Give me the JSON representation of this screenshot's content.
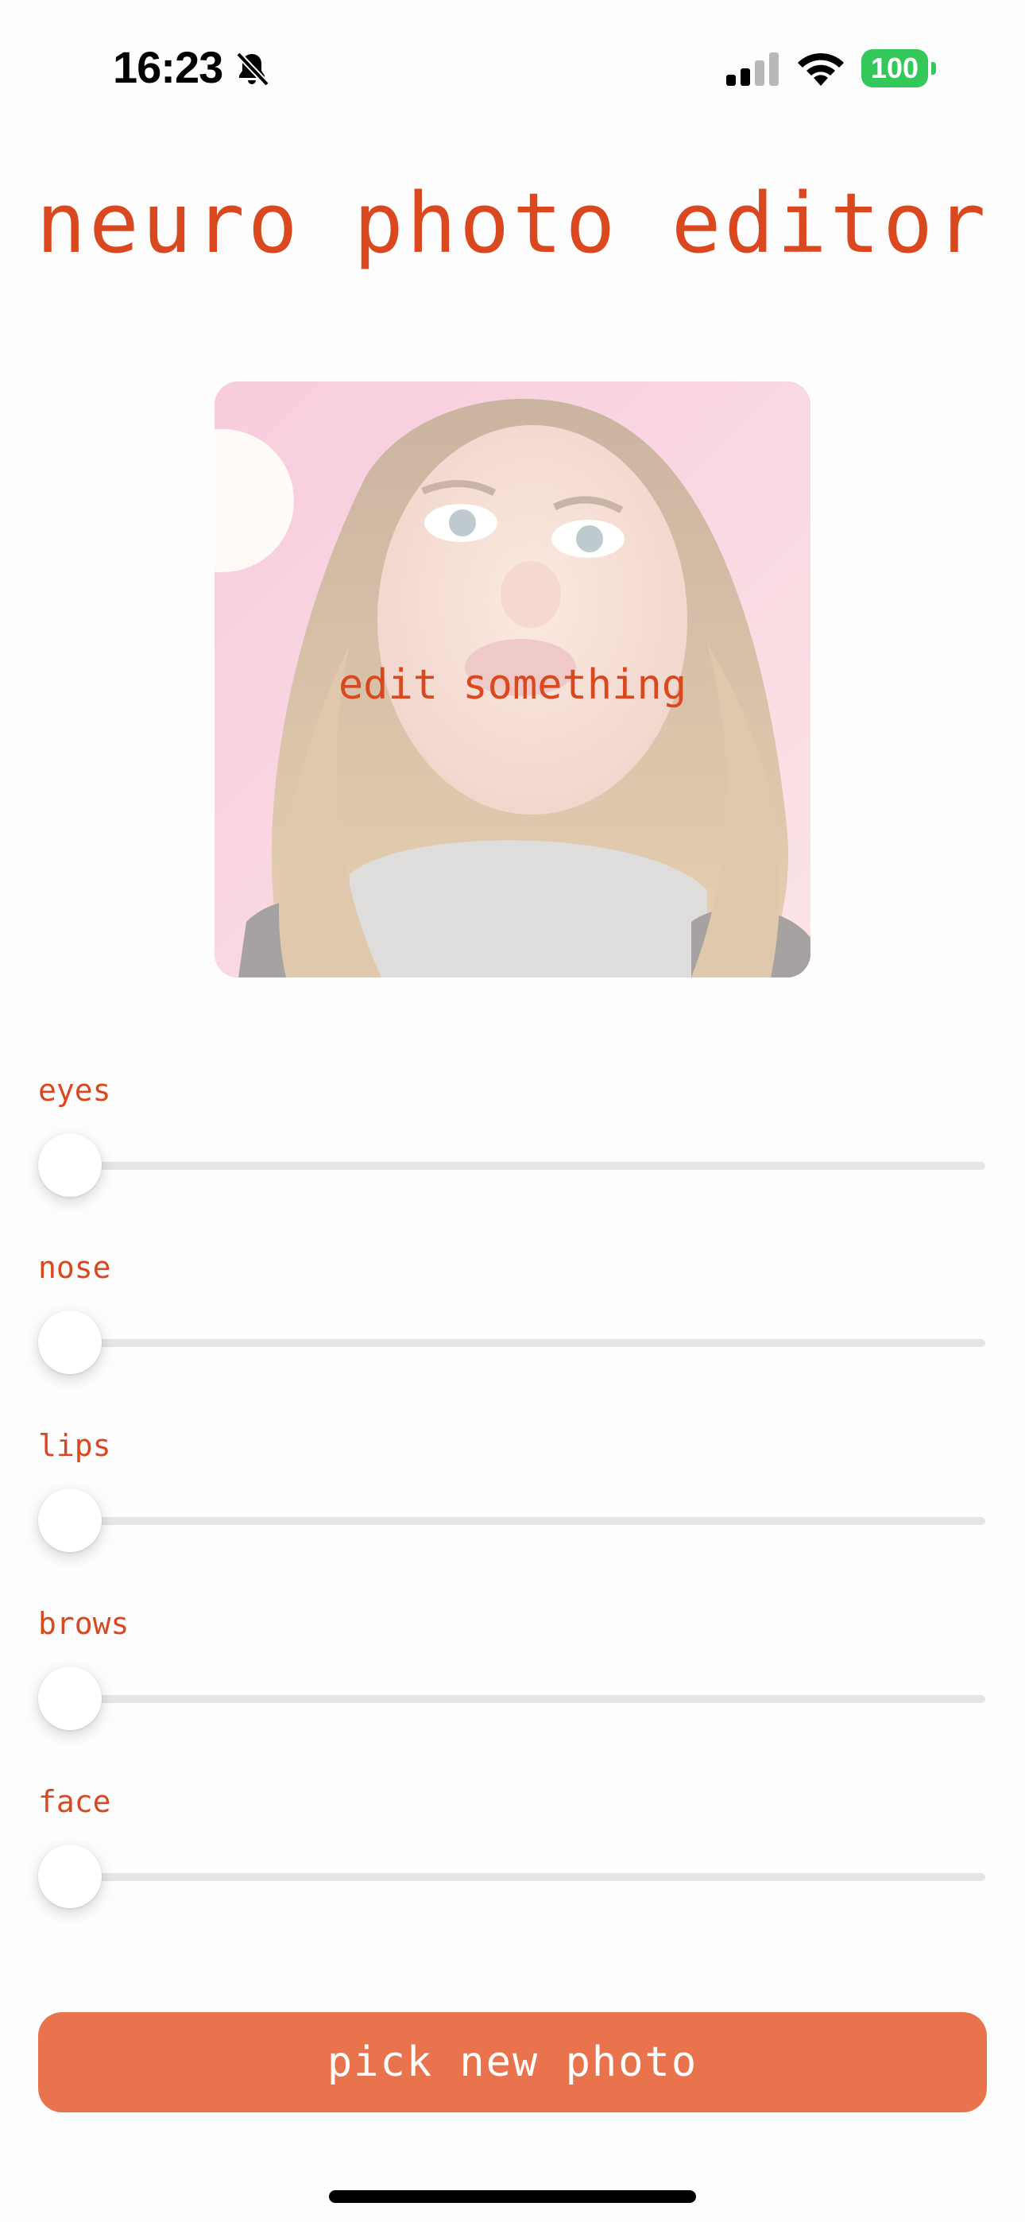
{
  "status_bar": {
    "time": "16:23",
    "silent_icon": "bell-slash-icon",
    "signal_icon": "cellular-signal-icon",
    "wifi_icon": "wifi-icon",
    "battery_level": "100",
    "battery_color": "#34c759"
  },
  "header": {
    "title": "neuro photo editor"
  },
  "photo": {
    "caption": "edit something"
  },
  "sliders": [
    {
      "label": "eyes",
      "value": 0
    },
    {
      "label": "nose",
      "value": 0
    },
    {
      "label": "lips",
      "value": 0
    },
    {
      "label": "brows",
      "value": 0
    },
    {
      "label": "face",
      "value": 0
    }
  ],
  "actions": {
    "pick_photo_label": "pick new photo"
  },
  "theme": {
    "accent": "#d9481f",
    "button": "#e8734c"
  }
}
